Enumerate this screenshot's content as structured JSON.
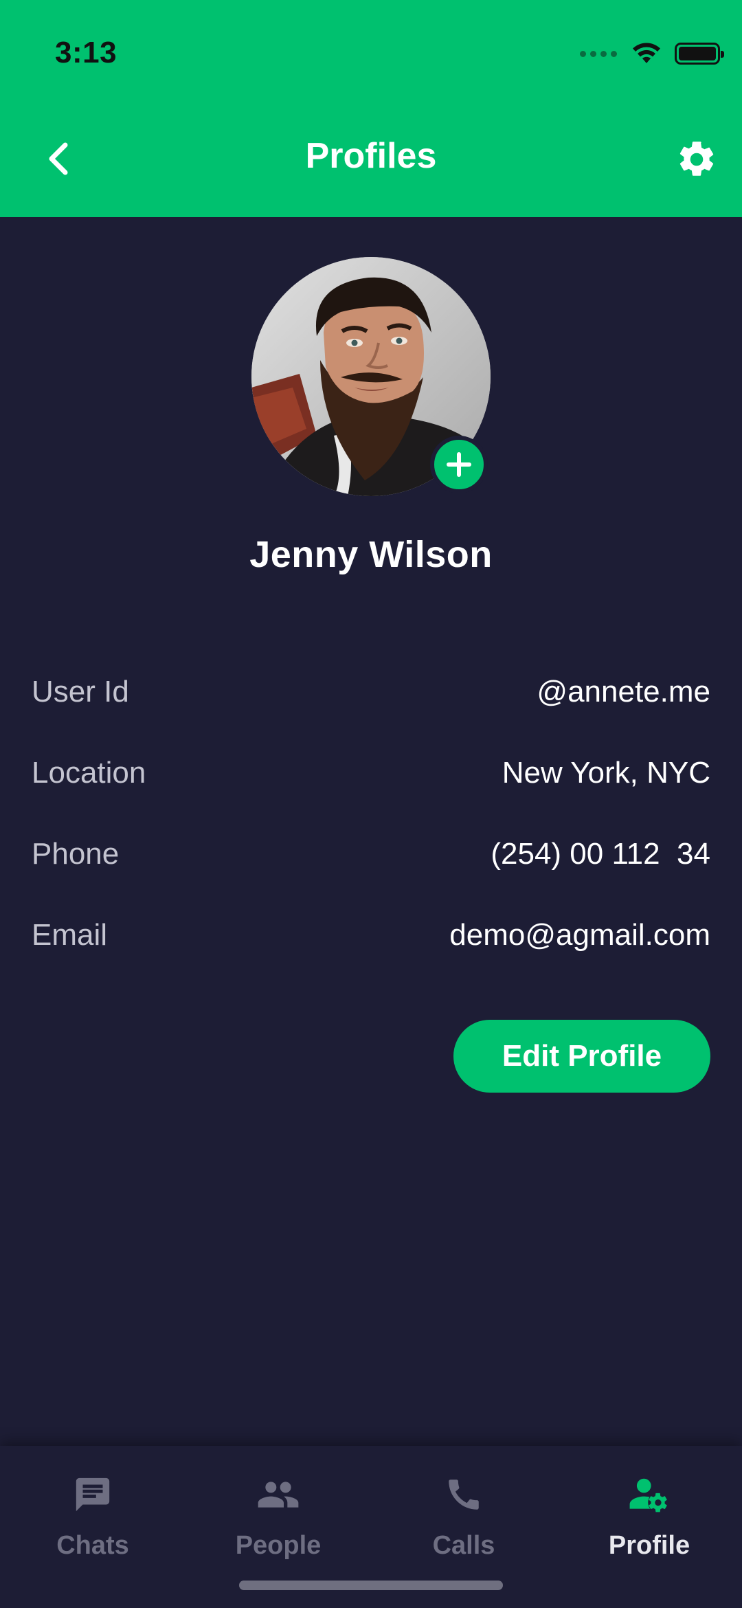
{
  "status_bar": {
    "time": "3:13"
  },
  "app_bar": {
    "title": "Profiles",
    "back_icon": "chevron-left-icon",
    "settings_icon": "gear-icon"
  },
  "profile": {
    "name": "Jenny Wilson",
    "avatar_action_icon": "plus-icon",
    "fields": [
      {
        "label": "User Id",
        "value": "@annete.me"
      },
      {
        "label": "Location",
        "value": "New York, NYC"
      },
      {
        "label": "Phone",
        "value": "(254) 00 112  34"
      },
      {
        "label": "Email",
        "value": "demo@agmail.com"
      }
    ],
    "edit_button_label": "Edit Profile"
  },
  "bottom_nav": {
    "items": [
      {
        "label": "Chats",
        "icon": "chat-icon",
        "active": false
      },
      {
        "label": "People",
        "icon": "people-icon",
        "active": false
      },
      {
        "label": "Calls",
        "icon": "phone-icon",
        "active": false
      },
      {
        "label": "Profile",
        "icon": "profile-settings-icon",
        "active": true
      }
    ]
  },
  "colors": {
    "accent": "#00c16f",
    "background": "#1d1d35",
    "text_primary": "#ffffff",
    "text_secondary": "#c4c4d0",
    "nav_inactive": "#6e6e82"
  }
}
